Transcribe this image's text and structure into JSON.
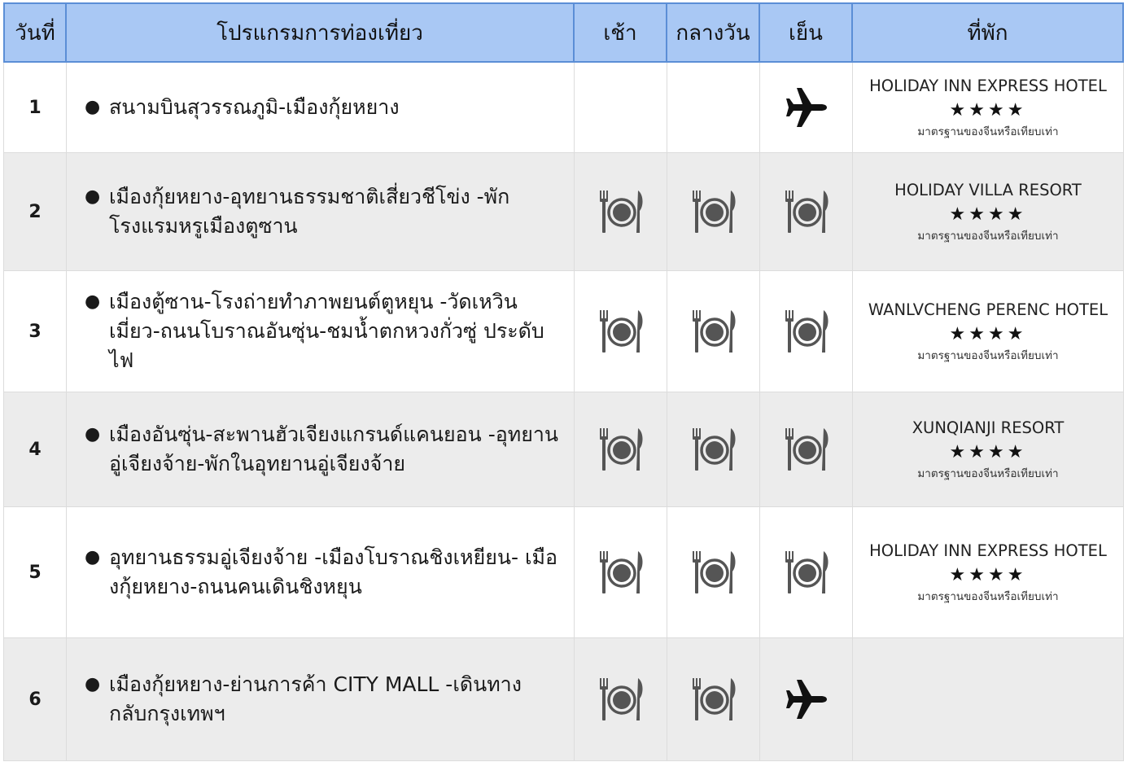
{
  "headers": {
    "day": "วันที่",
    "program": "โปรแกรมการท่องเที่ยว",
    "breakfast": "เช้า",
    "lunch": "กลางวัน",
    "dinner": "เย็น",
    "hotel": "ที่พัก"
  },
  "colors": {
    "header_bg": "#a9c8f4",
    "header_border": "#5b8ed6",
    "alt_row_bg": "#ececec",
    "meal_icon": "#555555"
  },
  "rows": [
    {
      "day": "1",
      "program": "สนามบินสุวรรณภูมิ-เมืองกุ้ยหยาง",
      "breakfast": "none",
      "lunch": "none",
      "dinner": "airplane-icon",
      "hotel": {
        "name": "HOLIDAY INN EXPRESS HOTEL",
        "stars": "★★★★",
        "note": "มาตรฐานของจีนหรือเทียบเท่า"
      }
    },
    {
      "day": "2",
      "program": "เมืองกุ้ยหยาง-อุทยานธรรมชาติเสี่ยวชีโข่ง -พัก โรงแรมหรูเมืองตูซาน",
      "breakfast": "meal-icon",
      "lunch": "meal-icon",
      "dinner": "meal-icon",
      "hotel": {
        "name": "HOLIDAY VILLA RESORT",
        "stars": "★★★★",
        "note": "มาตรฐานของจีนหรือเทียบเท่า"
      }
    },
    {
      "day": "3",
      "program": "เมืองตู้ซาน-โรงถ่ายทำภาพยนต์ตูหยุน -วัดเหวิน เมี่ยว-ถนนโบราณอันซุ่น-ชมน้ำตกหวงกั่วซู่ ประดับไฟ",
      "breakfast": "meal-icon",
      "lunch": "meal-icon",
      "dinner": "meal-icon",
      "hotel": {
        "name": "WANLVCHENG PERENC HOTEL",
        "stars": "★★★★",
        "note": "มาตรฐานของจีนหรือเทียบเท่า"
      }
    },
    {
      "day": "4",
      "program": "เมืองอันซุ่น-สะพานฮัวเจียงแกรนด์แคนยอน -อุทยานอู่เจียงจ้าย-พักในอุทยานอู่เจียงจ้าย",
      "breakfast": "meal-icon",
      "lunch": "meal-icon",
      "dinner": "meal-icon",
      "hotel": {
        "name": "XUNQIANJI RESORT",
        "stars": "★★★★",
        "note": "มาตรฐานของจีนหรือเทียบเท่า"
      }
    },
    {
      "day": "5",
      "program": "อุทยานธรรมอู่เจียงจ้าย -เมืองโบราณชิงเหยียน- เมืองกุ้ยหยาง-ถนนคนเดินชิงหยุน",
      "breakfast": "meal-icon",
      "lunch": "meal-icon",
      "dinner": "meal-icon",
      "hotel": {
        "name": "HOLIDAY INN EXPRESS HOTEL",
        "stars": "★★★★",
        "note": "มาตรฐานของจีนหรือเทียบเท่า"
      }
    },
    {
      "day": "6",
      "program": "เมืองกุ้ยหยาง-ย่านการค้า CITY MALL -เดินทาง กลับกรุงเทพฯ",
      "breakfast": "meal-icon",
      "lunch": "meal-icon",
      "dinner": "airplane-icon",
      "hotel": null
    }
  ]
}
